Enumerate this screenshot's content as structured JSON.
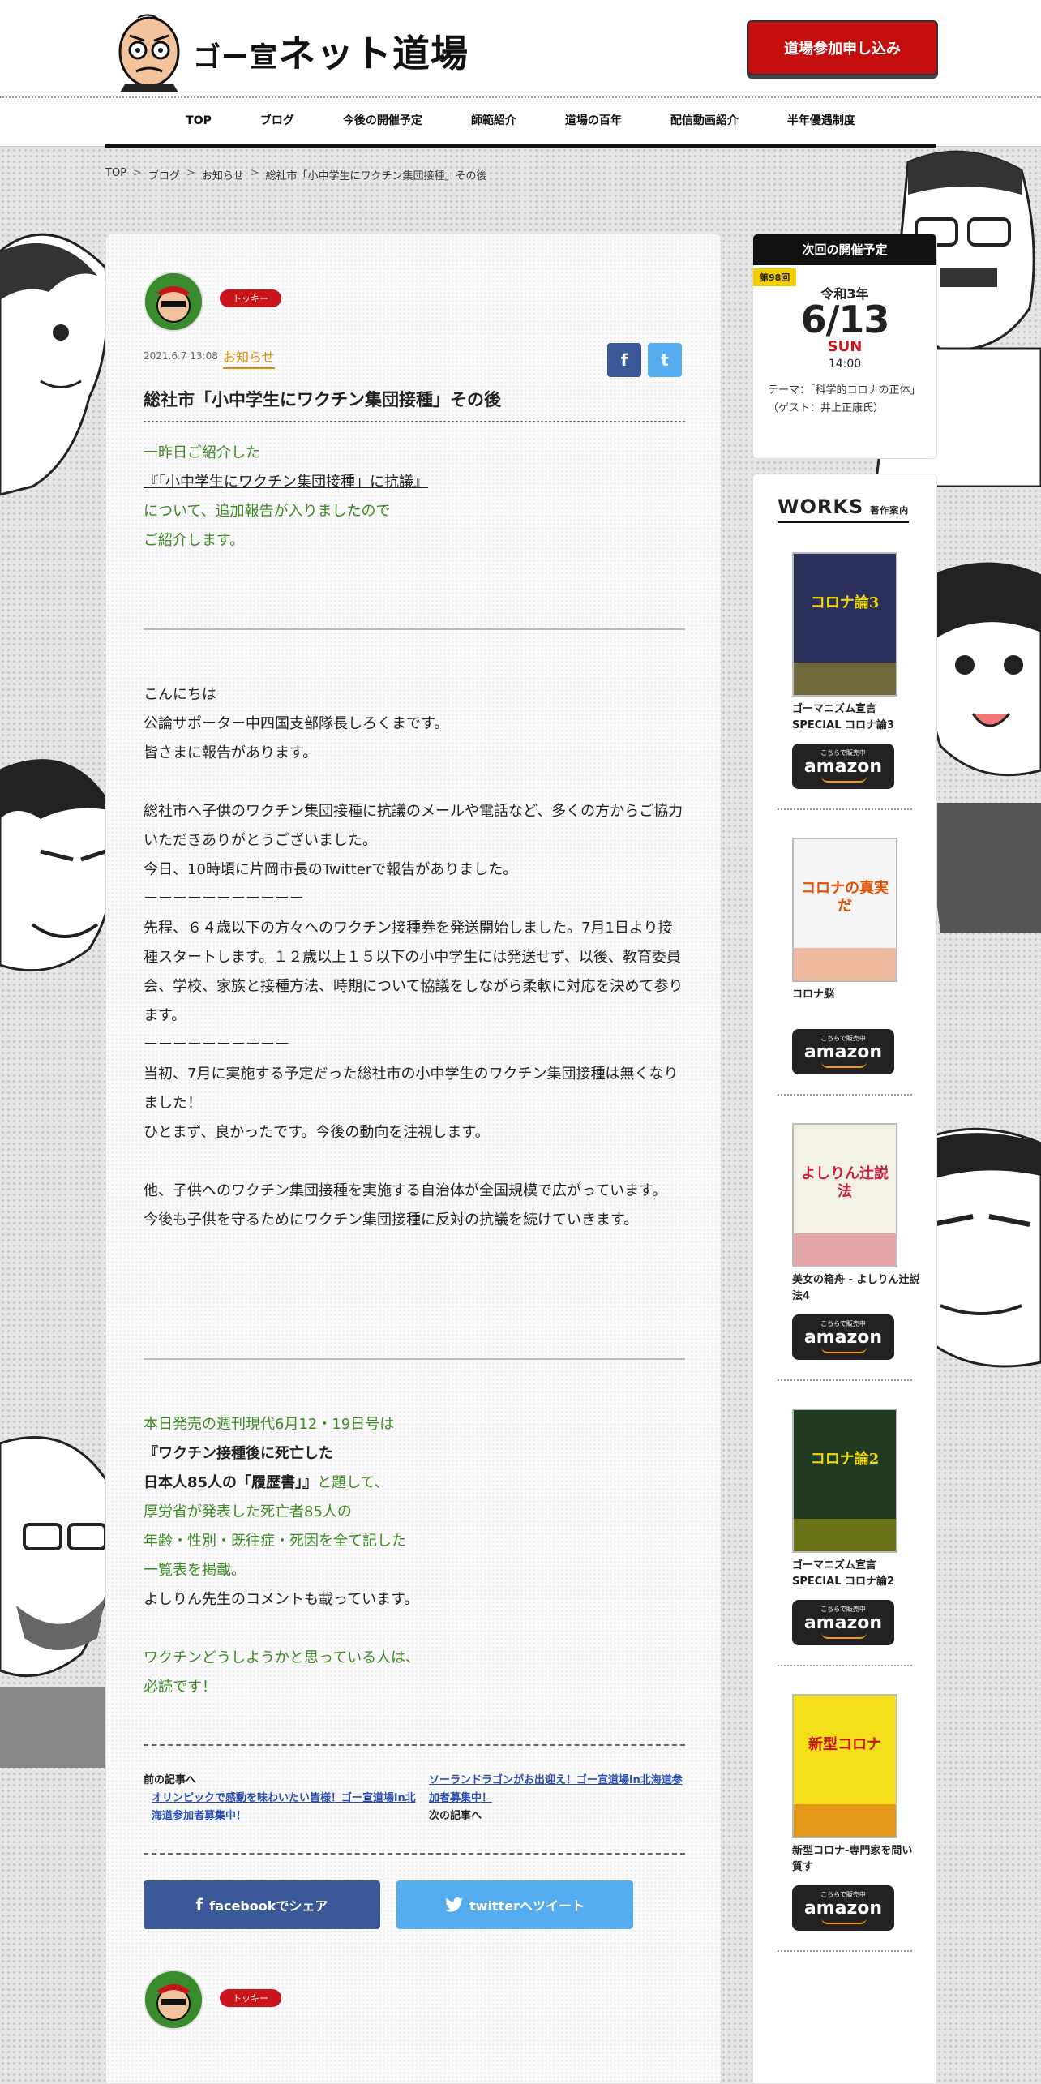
{
  "site": {
    "logo_small": "ゴー宣",
    "logo_large": "ネット道場",
    "apply_button": "道場参加申し込み"
  },
  "nav": [
    "TOP",
    "ブログ",
    "今後の開催予定",
    "師範紹介",
    "道場の百年",
    "配信動画紹介",
    "半年優遇制度"
  ],
  "breadcrumb": [
    "TOP",
    "ブログ",
    "お知らせ",
    "総社市「小中学生にワクチン集団接種」その後"
  ],
  "breadcrumb_sep": ">",
  "article": {
    "author_tag": "トッキー",
    "date": "2021.6.7 13:08",
    "category": "お知らせ",
    "fb_icon": "f",
    "tw_icon": "t",
    "title": "総社市「小中学生にワクチン集団接種」その後",
    "intro": {
      "l1": "一昨日ご紹介した",
      "l2": "『「小中学生にワクチン集団接種」に抗議』",
      "l3": "について、追加報告が入りましたので",
      "l4": "ご紹介します。"
    },
    "body": {
      "l1": "こんにちは",
      "l2": "公論サポーター中四国支部隊長しろくまです。",
      "l3": "皆さまに報告があります。",
      "l4": "総社市へ子供のワクチン集団接種に抗議のメールや電話など、多くの方からご協力いただきありがとうございました。",
      "l5": "今日、10時頃に片岡市長のTwitterで報告がありました。",
      "l6": "ーーーーーーーーーーー",
      "l7": "先程、６４歳以下の方々へのワクチン接種券を発送開始しました。7月1日より接種スタートします。１２歳以上１５以下の小中学生には発送せず、以後、教育委員会、学校、家族と接種方法、時期について協議をしながら柔軟に対応を決めて参ります。",
      "l8": "ーーーーーーーーーー",
      "l9": "当初、7月に実施する予定だった総社市の小中学生のワクチン集団接種は無くなりました！",
      "l10": "ひとまず、良かったです。今後の動向を注視します。",
      "l11": "他、子供へのワクチン集団接種を実施する自治体が全国規模で広がっています。",
      "l12": "今後も子供を守るためにワクチン集団接種に反対の抗議を続けていきます。"
    },
    "outro": {
      "l1": "本日発売の週刊現代6月12・19日号は",
      "l2": "『ワクチン接種後に死亡した",
      "l3a": "日本人85人の「履歴書」』",
      "l3b": "と題して、",
      "l4": "厚労省が発表した死亡者85人の",
      "l5": "年齢・性別・既往症・死因を全て記した",
      "l6": "一覧表を掲載。",
      "l7": "よしりん先生のコメントも載っています。",
      "l8": "ワクチンどうしようかと思っている人は、",
      "l9": "必読です！"
    },
    "prev_label": "前の記事へ",
    "prev_link": "オリンピックで感動を味わいたい皆様！ゴー宣道場in北海道参加者募集中！",
    "next_link": "ソーランドラゴンがお出迎え！ゴー宣道場in北海道参加者募集中！",
    "next_label": "次の記事へ",
    "fb_share": "facebookでシェア",
    "tw_share": "twitterへツイート",
    "author_tag_bottom": "トッキー"
  },
  "event": {
    "header": "次回の開催予定",
    "badge": "第98回",
    "year": "令和3年",
    "date": "6/13",
    "day": "SUN",
    "time": "14:00",
    "theme": "テーマ：「科学的コロナの正体」（ゲスト：井上正康氏）"
  },
  "works": {
    "title": "WORKS",
    "subtitle": "著作案内",
    "amazon_top": "こちらで販売中",
    "amazon_logo": "amazon",
    "books": [
      {
        "title": "ゴーマニズム宣言SPECIAL コロナ論3",
        "cover_text": "コロナ論3",
        "bg": "#2a2f5c",
        "accent": "#f0d800"
      },
      {
        "title": "コロナ脳",
        "cover_text": "コロナの真実だ",
        "bg": "#f4f4f4",
        "accent": "#e64c00"
      },
      {
        "title": "美女の箱舟 - よしりん辻説法4",
        "cover_text": "よしりん辻説法",
        "bg": "#f3f0e6",
        "accent": "#cc1e3a"
      },
      {
        "title": "ゴーマニズム宣言SPECIAL コロナ論2",
        "cover_text": "コロナ論2",
        "bg": "#1f3b20",
        "accent": "#f0d800"
      },
      {
        "title": "新型コロナ-専門家を問い質す",
        "cover_text": "新型コロナ",
        "bg": "#f3e01a",
        "accent": "#c8141a"
      }
    ]
  }
}
